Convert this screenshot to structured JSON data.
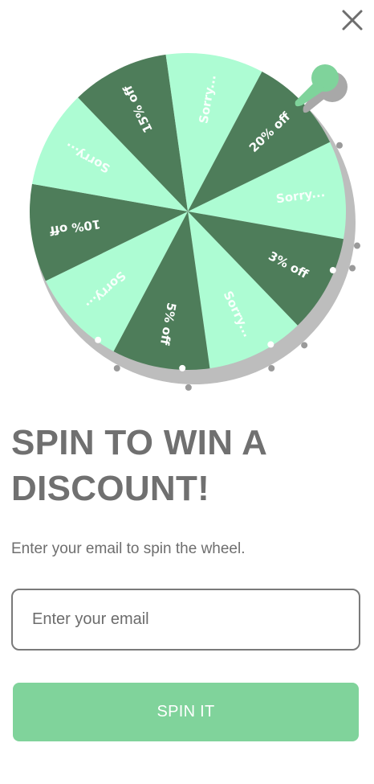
{
  "close": {
    "icon": "close-icon"
  },
  "wheel": {
    "colors": {
      "dark": "#4e7d5a",
      "light": "#adfcd3",
      "shadow": "#bdbdbd",
      "pointer": "#7fd39b",
      "text": "#ffffff"
    },
    "slices": [
      {
        "label": "Sorry...",
        "tone": "light"
      },
      {
        "label": "3% off",
        "tone": "dark"
      },
      {
        "label": "Sorry...",
        "tone": "light"
      },
      {
        "label": "5% off",
        "tone": "dark"
      },
      {
        "label": "Sorry...",
        "tone": "light"
      },
      {
        "label": "10% off",
        "tone": "dark"
      },
      {
        "label": "Sorry...",
        "tone": "light"
      },
      {
        "label": "15% off",
        "tone": "dark"
      },
      {
        "label": "Sorry...",
        "tone": "light"
      },
      {
        "label": "20% off",
        "tone": "dark"
      }
    ]
  },
  "headline": "SPIN TO WIN A DISCOUNT!",
  "subtitle": "Enter your email to spin the wheel.",
  "email": {
    "placeholder": "Enter your email",
    "value": ""
  },
  "spin_button": {
    "label": "SPIN IT",
    "color": "#80d39b"
  }
}
